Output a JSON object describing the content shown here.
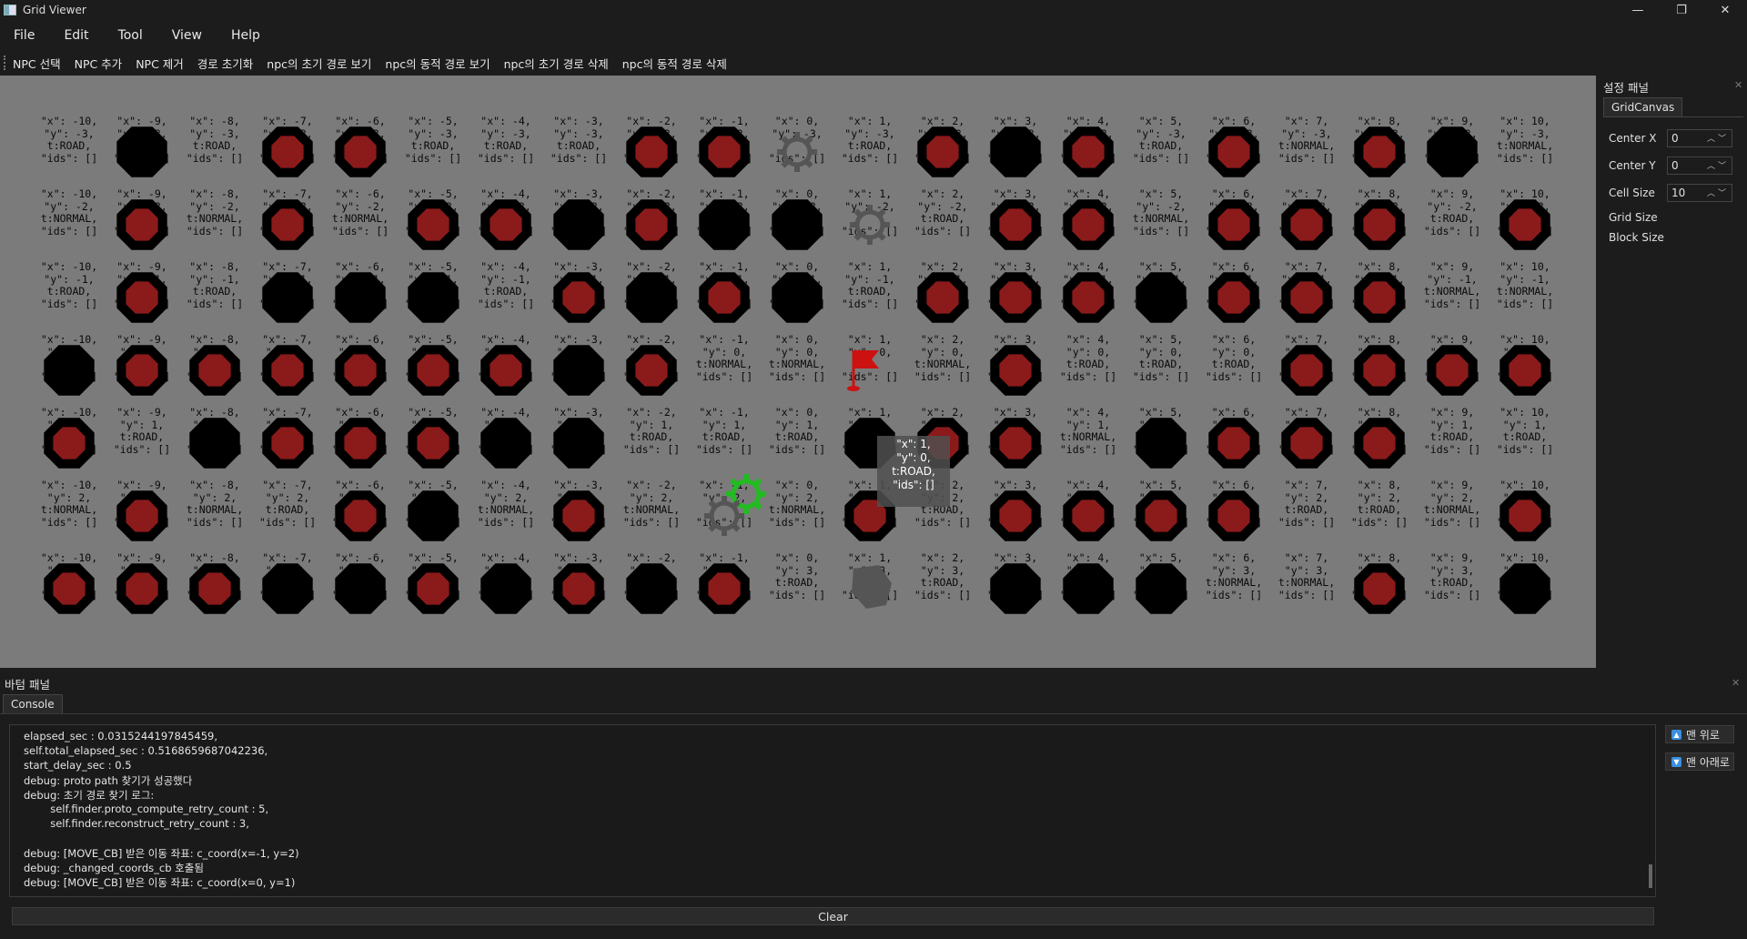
{
  "window": {
    "title": "Grid Viewer",
    "minimize": "—",
    "maximize": "❐",
    "close": "✕"
  },
  "menu": [
    "File",
    "Edit",
    "Tool",
    "View",
    "Help"
  ],
  "toolbar": [
    "NPC 선택",
    "NPC 추가",
    "NPC 제거",
    "경로 초기화",
    "npc의 초기 경로 보기",
    "npc의 동적 경로 보기",
    "npc의 초기 경로 삭제",
    "npc의 동적 경로 삭제"
  ],
  "grid": {
    "x_values": [
      -10,
      -9,
      -8,
      -7,
      -6,
      -5,
      -4,
      -3,
      -2,
      -1,
      0,
      1,
      2,
      3,
      4,
      5,
      6,
      7,
      8,
      9,
      10
    ],
    "y_values": [
      -3,
      -2,
      -1,
      0,
      1,
      2,
      3
    ],
    "cell_types": {
      "road": "t:ROAD,",
      "normal": "t:NORMAL,",
      "ids": "\"ids\": []"
    },
    "rows": [
      [
        "road",
        "block",
        "road",
        "water",
        "forest",
        "road",
        "road",
        "road",
        "forest",
        "water",
        "gear",
        "road",
        "water",
        "block",
        "water",
        "road",
        "water",
        "normal",
        "forest",
        "block",
        "normal"
      ],
      [
        "normal",
        "forest",
        "normal",
        "forest",
        "normal",
        "forest",
        "forest",
        "block",
        "forest",
        "block",
        "block",
        "gear",
        "road",
        "forest",
        "forest",
        "normal",
        "water",
        "water",
        "water",
        "road",
        "forest"
      ],
      [
        "road",
        "forest",
        "road",
        "block",
        "block",
        "block",
        "road",
        "forest",
        "block",
        "water",
        "block",
        "road",
        "forest",
        "water",
        "forest",
        "block",
        "forest",
        "forest",
        "water",
        "normal",
        "normal"
      ],
      [
        "block",
        "forest",
        "water",
        "forest",
        "water",
        "water",
        "forest",
        "block",
        "forest",
        "normal",
        "normal",
        "flag",
        "normal",
        "forest",
        "road",
        "road",
        "road",
        "water",
        "water",
        "forest",
        "water"
      ],
      [
        "forest",
        "road",
        "block",
        "forest",
        "forest",
        "forest",
        "block",
        "block",
        "road",
        "road",
        "road",
        "block",
        "water",
        "water",
        "normal",
        "block",
        "forest",
        "forest",
        "forest",
        "road",
        "road"
      ],
      [
        "normal",
        "forest",
        "normal",
        "road",
        "water",
        "block",
        "normal",
        "water",
        "normal",
        "npc",
        "normal",
        "forest",
        "road",
        "water",
        "forest",
        "water",
        "water",
        "road",
        "road",
        "normal",
        "forest"
      ],
      [
        "water",
        "forest",
        "water",
        "block",
        "block",
        "forest",
        "block",
        "forest",
        "block",
        "forest",
        "road",
        "grey",
        "road",
        "block",
        "block",
        "block",
        "normal",
        "normal",
        "forest",
        "road",
        "block"
      ]
    ],
    "tooltip": {
      "line1": "\"x\": 1,",
      "line2": "\"y\": 0,",
      "line3": "t:ROAD,",
      "line4": "\"ids\": []"
    }
  },
  "settings_panel": {
    "title": "설정 패널",
    "tab": "GridCanvas",
    "center_x_label": "Center X",
    "center_x": "0",
    "center_y_label": "Center Y",
    "center_y": "0",
    "cell_size_label": "Cell Size",
    "cell_size": "10",
    "grid_size_label": "Grid Size",
    "block_size_label": "Block Size"
  },
  "bottom_panel": {
    "title": "바텀 패널",
    "tab": "Console",
    "log": [
      "elapsed_sec : 0.0315244197845459,",
      "self.total_elapsed_sec : 0.5168659687042236,",
      "start_delay_sec : 0.5",
      "debug: proto path 찾기가 성공했다",
      "debug: 초기 경로 찾기 로그:",
      "        self.finder.proto_compute_retry_count : 5,",
      "        self.finder.reconstruct_retry_count : 3,",
      "",
      "debug: [MOVE_CB] 받은 이동 좌표: c_coord(x=-1, y=2)",
      "debug: _changed_coords_cb 호출됨",
      "debug: [MOVE_CB] 받은 이동 좌표: c_coord(x=0, y=1)"
    ],
    "scroll_top": "맨 위로",
    "scroll_bottom": "맨 아래로",
    "clear": "Clear"
  },
  "colors": {
    "background": "#1c1c1c",
    "canvas": "#7b7b7b",
    "block": "#000000",
    "terrain_fill": "#8b1a1a",
    "npc": "#22bb22",
    "flag": "#cc1111"
  }
}
